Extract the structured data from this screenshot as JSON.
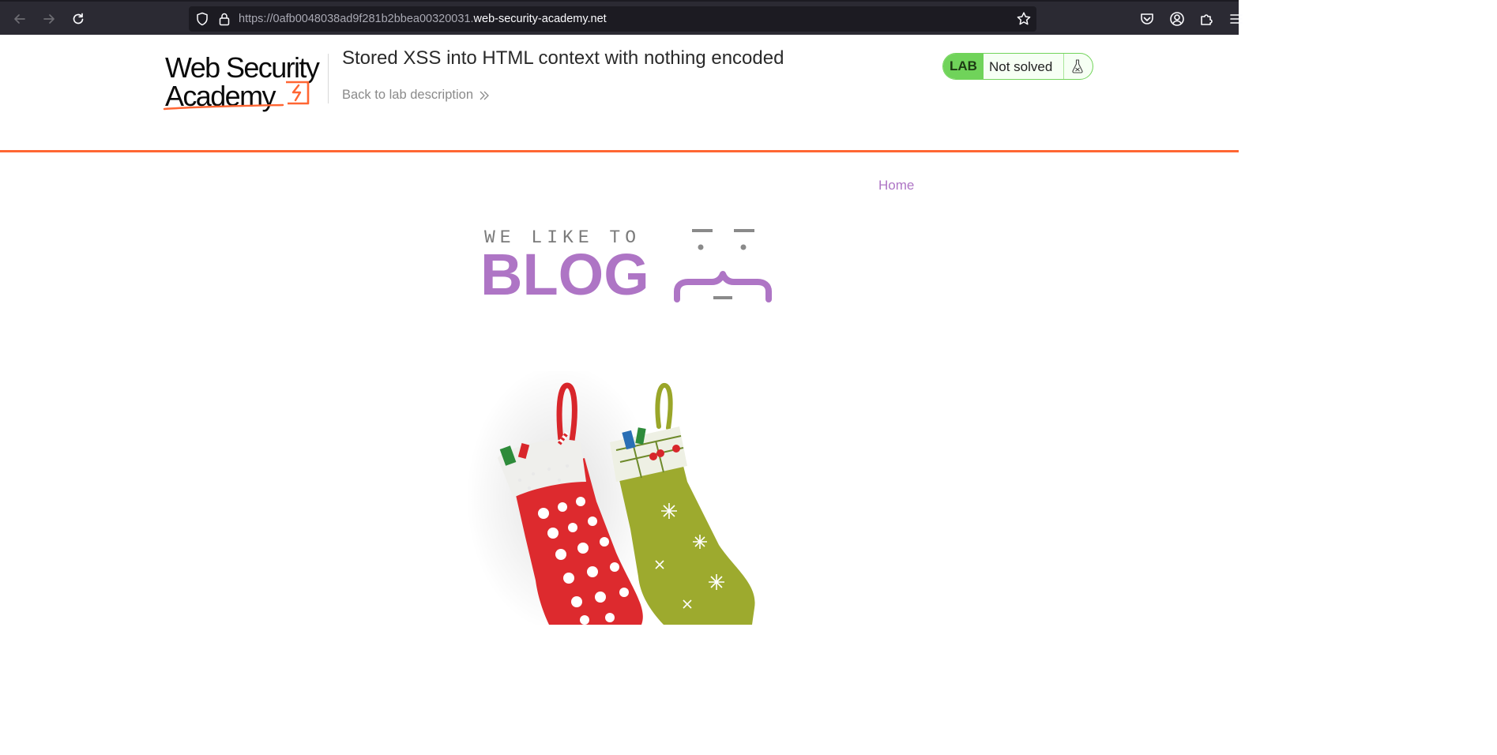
{
  "browser": {
    "url_prefix": "https://0afb0048038ad9f281b2bbea00320031.",
    "url_domain": "web-security-academy.net",
    "icons": [
      "back-arrow-icon",
      "forward-arrow-icon",
      "reload-icon",
      "shield-icon",
      "lock-icon",
      "star-icon",
      "pocket-icon",
      "account-icon",
      "extensions-icon",
      "menu-icon"
    ]
  },
  "lab_header": {
    "logo_line1": "Web Security",
    "logo_line2": "Academy",
    "title": "Stored XSS into HTML context with nothing encoded",
    "back_link": "Back to lab description",
    "status_badge": "LAB",
    "status_text": "Not solved",
    "accent_color": "#ff6633",
    "status_color": "#70d35a"
  },
  "blog": {
    "nav_home": "Home",
    "tagline": "WE LIKE TO",
    "title": "BLOG",
    "brand_color": "#ae75c5"
  },
  "hero_image": {
    "description": "christmas-stockings"
  }
}
